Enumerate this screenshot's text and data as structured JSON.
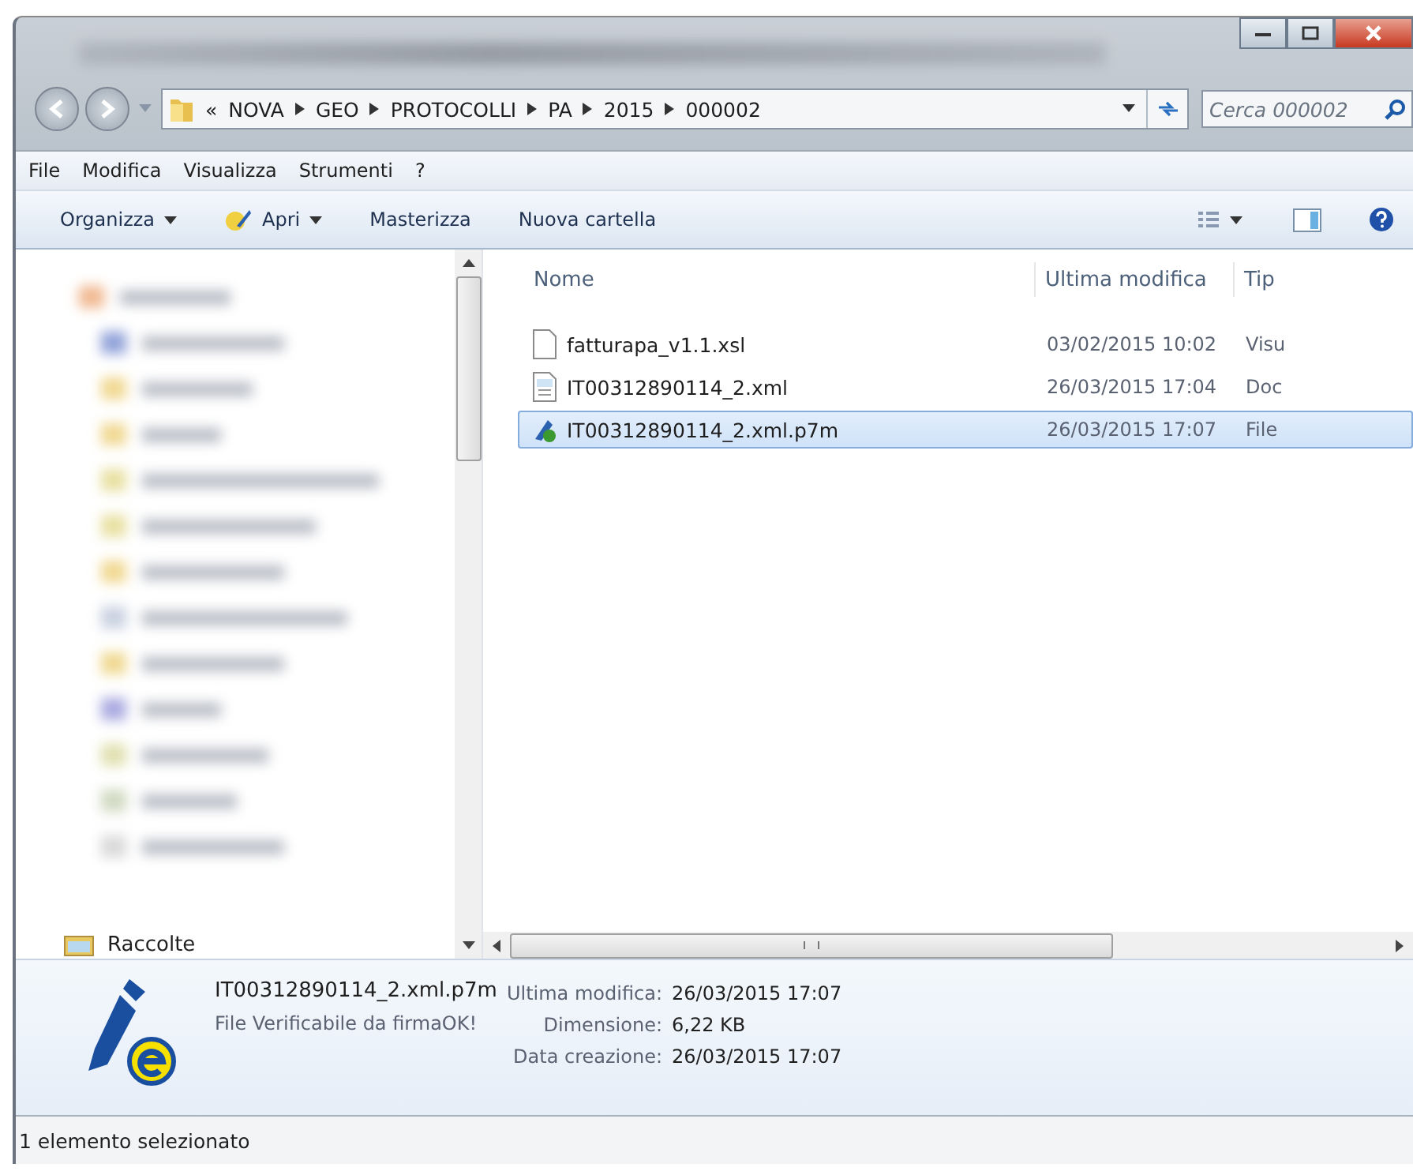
{
  "address": {
    "overflow": "«",
    "crumbs": [
      "NOVA",
      "GEO",
      "PROTOCOLLI",
      "PA",
      "2015",
      "000002"
    ]
  },
  "search": {
    "placeholder": "Cerca 000002"
  },
  "menu": [
    "File",
    "Modifica",
    "Visualizza",
    "Strumenti",
    "?"
  ],
  "toolbar": [
    {
      "label": "Organizza",
      "kind": "dropdown"
    },
    {
      "label": "Apri",
      "kind": "open"
    },
    {
      "label": "Masterizza",
      "kind": "plain"
    },
    {
      "label": "Nuova cartella",
      "kind": "plain"
    }
  ],
  "sidebar": {
    "footer_item": "Raccolte"
  },
  "columns": [
    "Nome",
    "Ultima modifica",
    "Tip"
  ],
  "files": [
    {
      "name": "fatturapa_v1.1.xsl",
      "modified": "03/02/2015 10:02",
      "type": "Visu",
      "kind": "blank",
      "selected": false
    },
    {
      "name": "IT00312890114_2.xml",
      "modified": "26/03/2015 17:04",
      "type": "Doc",
      "kind": "xml",
      "selected": false
    },
    {
      "name": "IT00312890114_2.xml.p7m",
      "modified": "26/03/2015 17:07",
      "type": "File",
      "kind": "signed",
      "selected": true
    }
  ],
  "details": {
    "name": "IT00312890114_2.xml.p7m",
    "description": "File Verificabile da firmaOK!",
    "properties": [
      {
        "label": "Ultima modifica:",
        "value": "26/03/2015 17:07"
      },
      {
        "label": "Dimensione:",
        "value": "6,22 KB"
      },
      {
        "label": "Data creazione:",
        "value": "26/03/2015 17:07"
      }
    ]
  },
  "status_bar": "1 elemento selezionato"
}
